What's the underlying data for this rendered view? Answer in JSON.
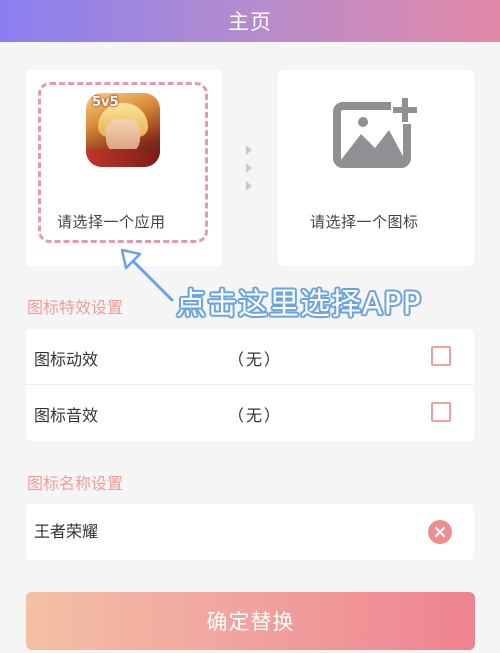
{
  "header": {
    "title": "主页"
  },
  "app_picker": {
    "label": "请选择一个应用",
    "app_badge": "5v5",
    "accent_color": "#e699ad"
  },
  "icon_picker": {
    "label": "请选择一个图标",
    "icon": "image-add-icon"
  },
  "hint": {
    "text": "点击这里选择APP",
    "color": "#6aa3df"
  },
  "effects_section": {
    "title": "图标特效设置",
    "rows": [
      {
        "label": "图标动效",
        "value": "（无）",
        "checked": false
      },
      {
        "label": "图标音效",
        "value": "（无）",
        "checked": false
      }
    ]
  },
  "name_section": {
    "title": "图标名称设置",
    "value": "王者荣耀",
    "clear_icon": "clear-icon"
  },
  "confirm_button": {
    "label": "确定替换"
  },
  "colors": {
    "header_gradient": [
      "#8a7ff0",
      "#e389a8"
    ],
    "section_title": "#ef9d9a",
    "checkbox": "#ef9f9c",
    "button_gradient": [
      "#f4c0a4",
      "#ef8290"
    ]
  }
}
